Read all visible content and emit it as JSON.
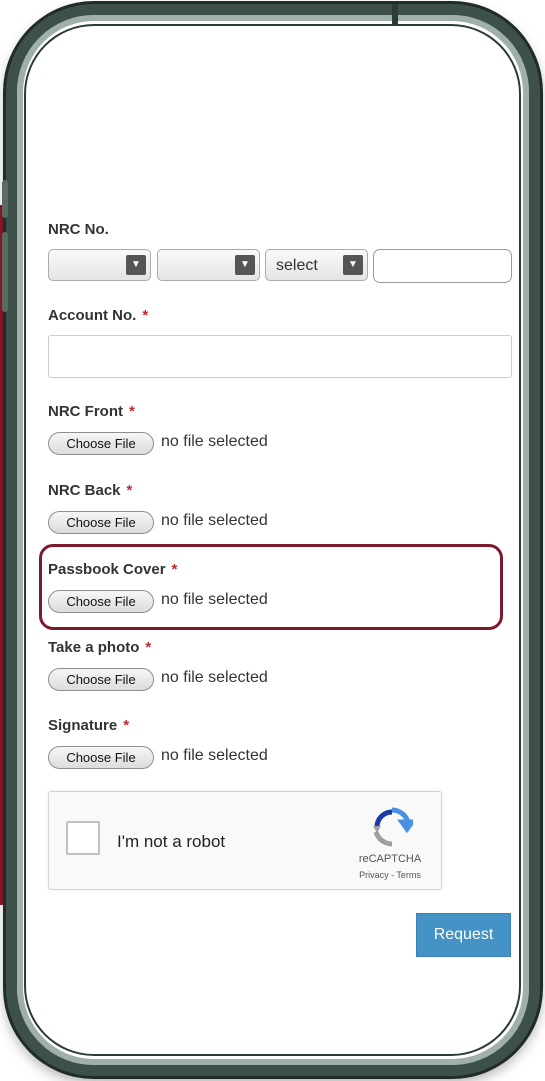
{
  "form": {
    "nrc": {
      "label": "NRC No.",
      "select1": "",
      "select2": "",
      "select3": "select",
      "number_value": ""
    },
    "account": {
      "label": "Account No.",
      "value": "",
      "placeholder": ""
    },
    "required_marker": "*",
    "file_fields": [
      {
        "label": "NRC Front",
        "button": "Choose File",
        "status": "no file selected"
      },
      {
        "label": "NRC Back",
        "button": "Choose File",
        "status": "no file selected"
      },
      {
        "label": "Passbook Cover",
        "button": "Choose File",
        "status": "no file selected",
        "highlighted": true
      },
      {
        "label": "Take a photo",
        "button": "Choose File",
        "status": "no file selected"
      },
      {
        "label": "Signature",
        "button": "Choose File",
        "status": "no file selected"
      }
    ],
    "captcha": {
      "label": "I'm not a robot",
      "brand": "reCAPTCHA",
      "links": "Privacy - Terms",
      "checked": false
    },
    "submit_label": "Request"
  },
  "colors": {
    "accent_red": "#7d1a2c",
    "required": "#c0272d",
    "button_blue": "#4592c6",
    "phone_frame": "#3e5149"
  }
}
